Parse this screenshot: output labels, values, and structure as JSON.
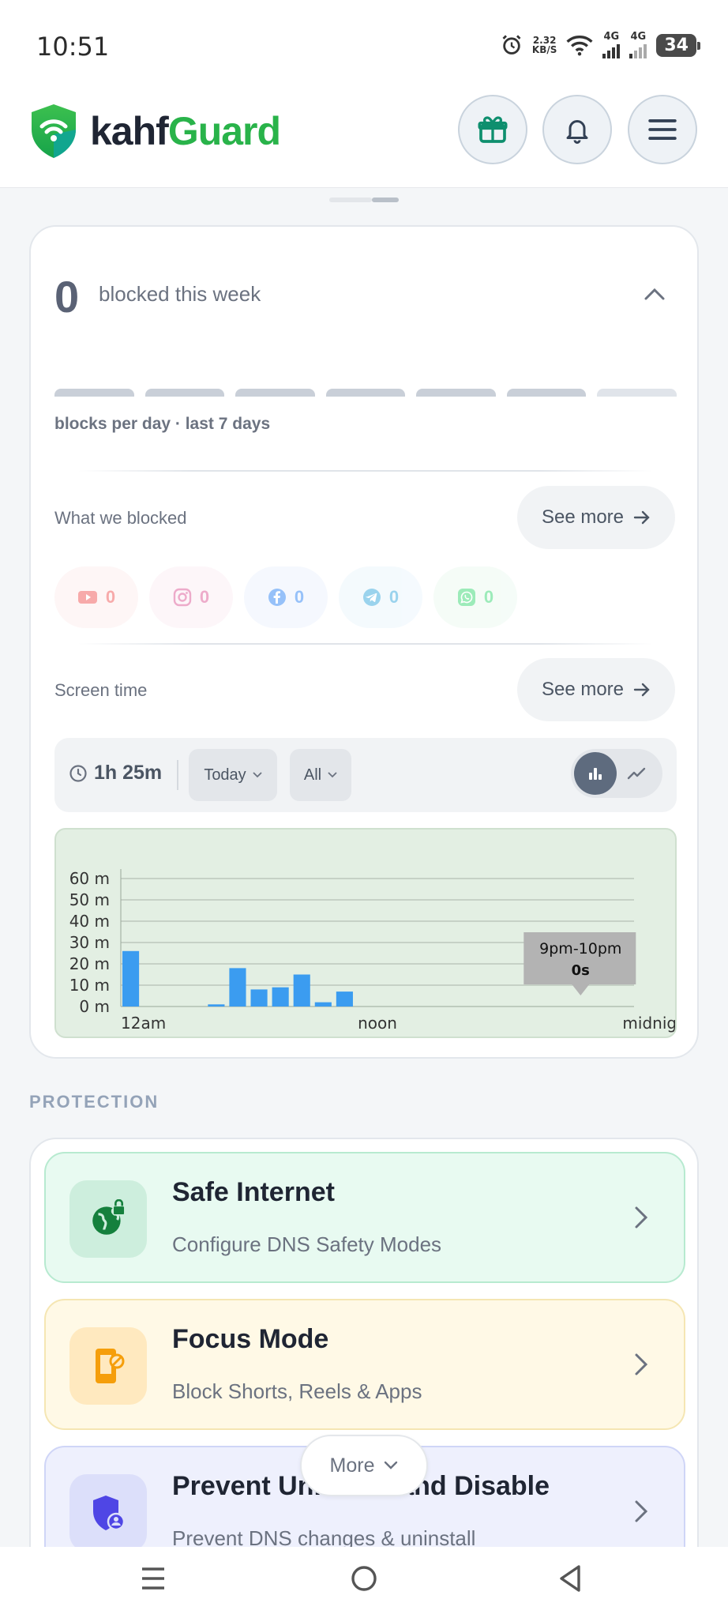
{
  "status_bar": {
    "time": "10:51",
    "speed_value": "2.32",
    "speed_unit": "KB/S",
    "network1": "4G",
    "network2": "4G",
    "battery": "34"
  },
  "header": {
    "brand_part1": "kahf",
    "brand_part2": "Guard",
    "brand_colors": {
      "dark": "#1f2533",
      "green": "#29b34a"
    },
    "icons": [
      "gift-icon",
      "bell-icon",
      "menu-icon"
    ]
  },
  "weekly": {
    "blocked_count": "0",
    "blocked_label": "blocked this week",
    "chart_caption": "blocks per day · last 7 days",
    "what_we_blocked_label": "What we blocked",
    "see_more_label": "See more",
    "apps": [
      {
        "name": "youtube-icon",
        "count": "0",
        "color": "#ef4444",
        "bg": "#fdecec"
      },
      {
        "name": "instagram-icon",
        "count": "0",
        "color": "#d9468b",
        "bg": "#fcecf3"
      },
      {
        "name": "facebook-icon",
        "count": "0",
        "color": "#1877f2",
        "bg": "#e9f1fd"
      },
      {
        "name": "telegram-icon",
        "count": "0",
        "color": "#229ed9",
        "bg": "#e8f5fc"
      },
      {
        "name": "whatsapp-icon",
        "count": "0",
        "color": "#25d366",
        "bg": "#e9f9ef"
      }
    ]
  },
  "screen_time": {
    "label": "Screen time",
    "see_more_label": "See more",
    "total": "1h 25m",
    "period": "Today",
    "filter": "All",
    "view_mode": "bar"
  },
  "chart_data": {
    "type": "bar",
    "title": "",
    "xlabel": "",
    "ylabel": "",
    "x_ticks": [
      "12am",
      "noon",
      "midnight"
    ],
    "y_ticks": [
      "0 m",
      "10 m",
      "20 m",
      "30 m",
      "40 m",
      "50 m",
      "60 m"
    ],
    "ylim": [
      0,
      60
    ],
    "unit": "m",
    "categories": [
      "0",
      "1",
      "2",
      "3",
      "4",
      "5",
      "6",
      "7",
      "8",
      "9",
      "10",
      "11",
      "12",
      "13",
      "14",
      "15",
      "16",
      "17",
      "18",
      "19",
      "20",
      "21",
      "22",
      "23"
    ],
    "values": [
      26,
      0,
      0,
      0,
      1,
      18,
      8,
      9,
      15,
      2,
      7,
      0,
      0,
      0,
      0,
      0,
      0,
      0,
      0,
      0,
      0,
      0,
      0,
      0
    ],
    "tooltip": {
      "range": "9pm-10pm",
      "value": "0s"
    },
    "bar_color": "#3b9cf0",
    "grid": true
  },
  "protection": {
    "heading": "PROTECTION",
    "items": [
      {
        "title": "Safe Internet",
        "subtitle": "Configure DNS Safety Modes",
        "icon": "globe-lock-icon",
        "bg": "#e8faf1",
        "border": "#b7ead0",
        "icon_bg": "#cdeedd"
      },
      {
        "title": "Focus Mode",
        "subtitle": "Block Shorts, Reels & Apps",
        "icon": "phone-block-icon",
        "bg": "#fff9e6",
        "border": "#f5e6b3",
        "icon_bg": "#ffe9bf"
      },
      {
        "title": "Prevent Uninstall and Disable",
        "subtitle": "Prevent DNS changes & uninstall",
        "icon": "shield-user-icon",
        "bg": "#eef0fd",
        "border": "#cfd5f7",
        "icon_bg": "#dcdffa"
      }
    ],
    "more_label": "More"
  }
}
